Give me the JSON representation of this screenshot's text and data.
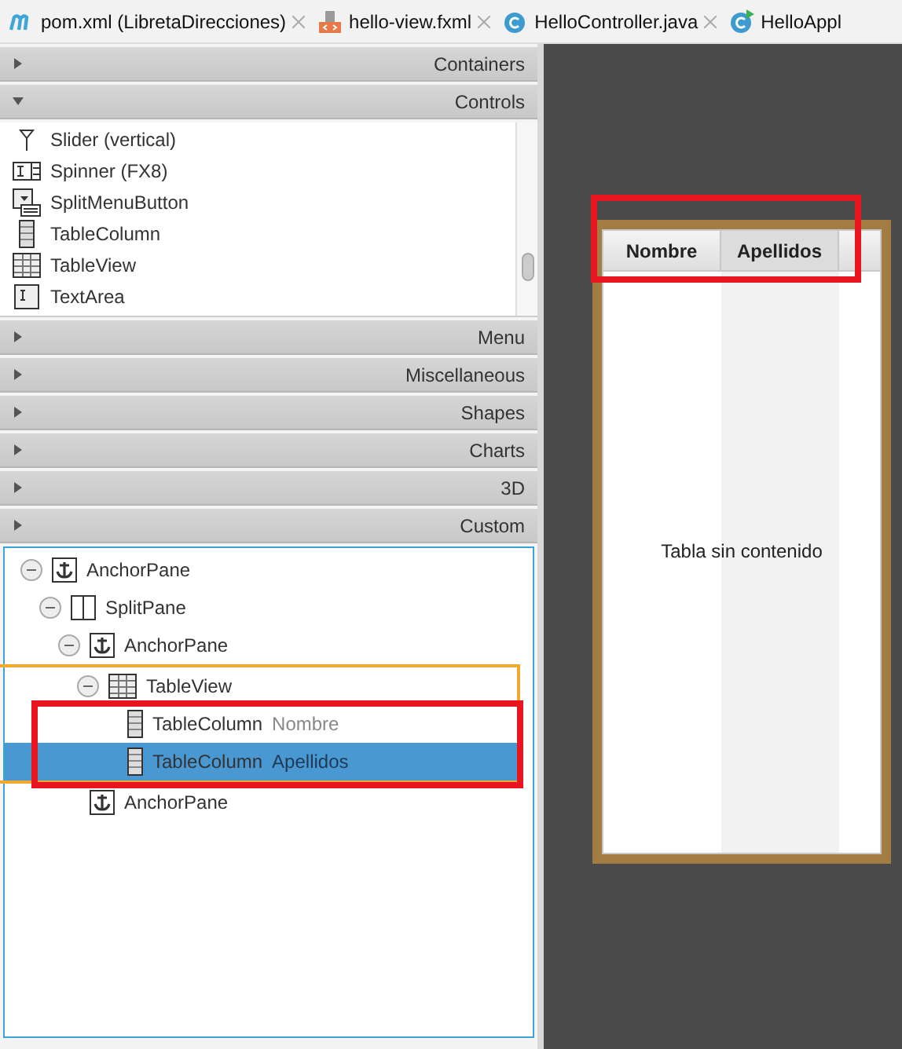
{
  "tabs": [
    {
      "label": "pom.xml (LibretaDirecciones)",
      "kind": "maven",
      "closable": true
    },
    {
      "label": "hello-view.fxml",
      "kind": "fxml",
      "closable": true
    },
    {
      "label": "HelloController.java",
      "kind": "class",
      "closable": true
    },
    {
      "label": "HelloAppl",
      "kind": "class-run",
      "closable": false
    }
  ],
  "library": {
    "sections_before": [
      {
        "label": "Containers",
        "expanded": false
      },
      {
        "label": "Controls",
        "expanded": true
      }
    ],
    "items": [
      {
        "label": "Slider  (vertical)",
        "kind": "slider"
      },
      {
        "label": "Spinner  (FX8)",
        "kind": "spinner"
      },
      {
        "label": "SplitMenuButton",
        "kind": "splitmenu"
      },
      {
        "label": "TableColumn",
        "kind": "column"
      },
      {
        "label": "TableView",
        "kind": "table"
      },
      {
        "label": "TextArea",
        "kind": "textarea"
      }
    ],
    "sections_after": [
      {
        "label": "Menu",
        "expanded": false
      },
      {
        "label": "Miscellaneous",
        "expanded": false
      },
      {
        "label": "Shapes",
        "expanded": false
      },
      {
        "label": "Charts",
        "expanded": false
      },
      {
        "label": "3D",
        "expanded": false
      },
      {
        "label": "Custom",
        "expanded": false
      }
    ]
  },
  "hierarchy": [
    {
      "label": "AnchorPane",
      "kind": "anchor",
      "expanded": true,
      "children": [
        {
          "label": "SplitPane",
          "kind": "split",
          "expanded": true,
          "children": [
            {
              "label": "AnchorPane",
              "kind": "anchor",
              "expanded": true,
              "children": [
                {
                  "label": "TableView",
                  "kind": "table",
                  "expanded": true,
                  "highlighted": true,
                  "children": [
                    {
                      "label": "TableColumn",
                      "detail": "Nombre",
                      "kind": "column",
                      "selected": false
                    },
                    {
                      "label": "TableColumn",
                      "detail": "Apellidos",
                      "kind": "column",
                      "selected": true
                    }
                  ]
                }
              ]
            },
            {
              "label": "AnchorPane",
              "kind": "anchor"
            }
          ]
        }
      ]
    }
  ],
  "canvas": {
    "columns": [
      {
        "label": "Nombre",
        "selected": false
      },
      {
        "label": "Apellidos",
        "selected": true
      }
    ],
    "placeholder": "Tabla sin contenido"
  }
}
